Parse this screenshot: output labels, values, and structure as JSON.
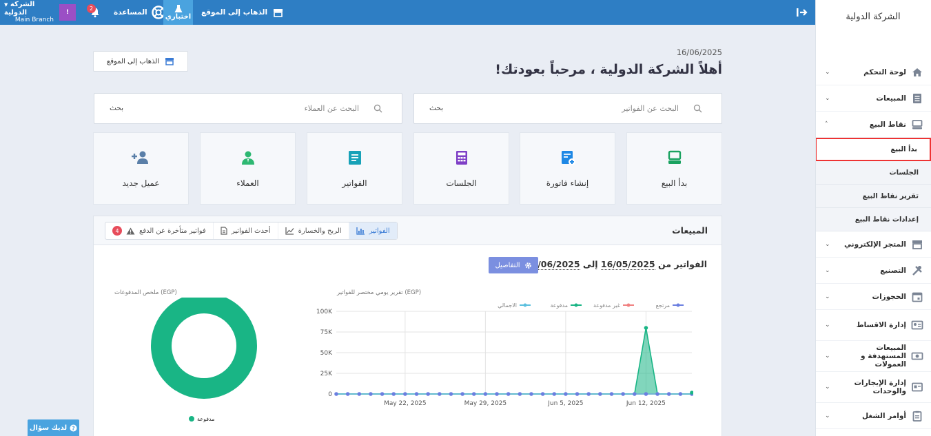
{
  "topbar": {
    "company_name": "الشركة الدولية",
    "branch": "Main Branch",
    "user_badge": "!",
    "notifications_count": "2",
    "help_label": "المساعدة",
    "try_label": "اختباري",
    "goto_site_label": "الذهاب إلى الموقع",
    "colors": {
      "bar": "#2e7ec4",
      "accent": "#4aa3df"
    }
  },
  "sidebar": {
    "brand": "الشركة الدولية",
    "items": [
      {
        "label": "لوحة التحكم",
        "icon": "home-icon",
        "chevron": "⌄"
      },
      {
        "label": "المبيعات",
        "icon": "list-icon",
        "chevron": "⌄"
      },
      {
        "label": "نقاط البيع",
        "icon": "pos-icon",
        "chevron": "˄"
      }
    ],
    "sub_items": [
      {
        "label": "بدأ البيع",
        "active": true
      },
      {
        "label": "الجلسات"
      },
      {
        "label": "تقرير نقاط البيع"
      },
      {
        "label": "إعدادات نقاط البيع"
      }
    ],
    "items_after": [
      {
        "label": "المتجر الإلكتروني",
        "icon": "store-icon"
      },
      {
        "label": "التصنيع",
        "icon": "tools-icon"
      },
      {
        "label": "الحجوزات",
        "icon": "calendar-icon"
      },
      {
        "label": "إدارة الاقساط",
        "icon": "installments-icon"
      },
      {
        "label": "المبيعات المستهدفة و العمولات",
        "icon": "money-icon"
      },
      {
        "label": "إدارة الإيجارات والوحدات",
        "icon": "rent-icon"
      },
      {
        "label": "أوامر الشغل",
        "icon": "clipboard-icon"
      }
    ]
  },
  "main": {
    "date": "16/06/2025",
    "welcome": "أهلاً الشركة الدولية ، مرحباً بعودتك!",
    "goto_site_button": "الذهاب إلى الموقع",
    "search_invoices": {
      "placeholder": "البحث عن الفواتير",
      "button": "بحث"
    },
    "search_clients": {
      "placeholder": "البحث عن العملاء",
      "button": "بحث"
    },
    "cards": [
      {
        "label": "بدأ البيع",
        "icon": "pos-terminal-icon",
        "color": "#1aa260"
      },
      {
        "label": "إنشاء فاتورة",
        "icon": "add-invoice-icon",
        "color": "#1e88e5"
      },
      {
        "label": "الجلسات",
        "icon": "calculator-icon",
        "color": "#7e3fc6"
      },
      {
        "label": "الفواتير",
        "icon": "invoice-icon",
        "color": "#17a2b8"
      },
      {
        "label": "العملاء",
        "icon": "users-icon",
        "color": "#2eb872"
      },
      {
        "label": "عميل جديد",
        "icon": "add-user-icon",
        "color": "#5a7fa8"
      }
    ]
  },
  "sales_panel": {
    "title": "المبيعات",
    "tabs": [
      {
        "label": "الفواتير",
        "icon": "bar-chart-icon",
        "active": true
      },
      {
        "label": "الربح والخسارة",
        "icon": "line-chart-icon"
      },
      {
        "label": "أحدث الفواتير",
        "icon": "document-icon"
      },
      {
        "label": "فواتير متأخرة عن الدفع",
        "icon": "warning-icon",
        "badge": "4"
      }
    ],
    "range_prefix": "الفواتير من",
    "range_from": "16/05/2025",
    "range_to_word": "إلى",
    "range_to": "16/06/2025",
    "details_button": "التفاصيل"
  },
  "help_button": "لديك سؤال",
  "chart_data": [
    {
      "type": "line",
      "title": "تقرير يومي مختصر للفواتير (EGP)",
      "x_tick_labels": [
        "May 22, 2025",
        "May 29, 2025",
        "Jun 5, 2025",
        "Jun 12, 2025"
      ],
      "y_tick_labels": [
        "0",
        "25K",
        "50K",
        "75K",
        "100K"
      ],
      "ylim": [
        0,
        100000
      ],
      "x": [
        "2025-05-16",
        "2025-05-17",
        "2025-05-18",
        "2025-05-19",
        "2025-05-20",
        "2025-05-21",
        "2025-05-22",
        "2025-05-23",
        "2025-05-24",
        "2025-05-25",
        "2025-05-26",
        "2025-05-27",
        "2025-05-28",
        "2025-05-29",
        "2025-05-30",
        "2025-05-31",
        "2025-06-01",
        "2025-06-02",
        "2025-06-03",
        "2025-06-04",
        "2025-06-05",
        "2025-06-06",
        "2025-06-07",
        "2025-06-08",
        "2025-06-09",
        "2025-06-10",
        "2025-06-11",
        "2025-06-12",
        "2025-06-13",
        "2025-06-14",
        "2025-06-15",
        "2025-06-16"
      ],
      "series": [
        {
          "name": "مرتجع",
          "color": "#6b7fe0",
          "values": [
            0,
            0,
            0,
            0,
            0,
            0,
            0,
            0,
            0,
            0,
            0,
            0,
            0,
            0,
            0,
            0,
            0,
            0,
            0,
            0,
            0,
            0,
            0,
            0,
            0,
            0,
            0,
            0,
            0,
            0,
            0,
            0
          ]
        },
        {
          "name": "غير مدفوعة",
          "color": "#f08080",
          "values": [
            0,
            0,
            0,
            0,
            0,
            0,
            0,
            0,
            0,
            0,
            0,
            0,
            0,
            0,
            0,
            0,
            0,
            0,
            0,
            0,
            0,
            0,
            0,
            0,
            0,
            0,
            0,
            0,
            0,
            0,
            0,
            0
          ]
        },
        {
          "name": "مدفوعة",
          "color": "#19b585",
          "values": [
            0,
            0,
            0,
            0,
            0,
            0,
            0,
            0,
            0,
            0,
            0,
            0,
            0,
            0,
            0,
            0,
            0,
            0,
            0,
            0,
            0,
            0,
            0,
            0,
            0,
            0,
            0,
            80000,
            0,
            0,
            0,
            0
          ]
        },
        {
          "name": "الاجمالي",
          "color": "#5bc0de",
          "values": [
            0,
            0,
            0,
            0,
            0,
            0,
            0,
            0,
            0,
            0,
            0,
            0,
            0,
            0,
            0,
            0,
            0,
            0,
            0,
            0,
            0,
            0,
            0,
            0,
            0,
            0,
            0,
            0,
            0,
            0,
            0,
            0
          ]
        }
      ],
      "grid": true,
      "legend": "top"
    },
    {
      "type": "pie",
      "title": "ملخص المدفوعات (EGP)",
      "donut": true,
      "slices": [
        {
          "name": "مدفوعة",
          "value": 100,
          "color": "#19b585"
        }
      ],
      "legend": "bottom"
    }
  ]
}
